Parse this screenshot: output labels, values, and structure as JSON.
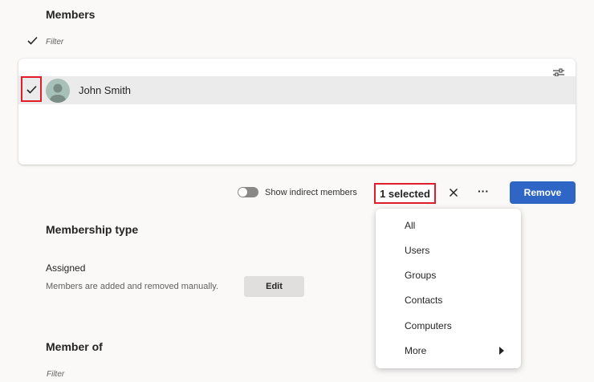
{
  "members": {
    "title": "Members",
    "filter_placeholder": "Filter",
    "rows": [
      {
        "name": "John Smith",
        "selected": true
      }
    ]
  },
  "toolbar": {
    "show_indirect_label": "Show indirect members",
    "selected_count_label": "1 selected",
    "more_label": "···",
    "remove_label": "Remove"
  },
  "membership_type": {
    "title": "Membership type",
    "value": "Assigned",
    "description": "Members are added and removed manually.",
    "edit_label": "Edit"
  },
  "member_of": {
    "title": "Member of",
    "filter_placeholder": "Filter"
  },
  "filter_menu": {
    "items": [
      "All",
      "Users",
      "Groups",
      "Contacts",
      "Computers",
      "More"
    ]
  },
  "colors": {
    "accent": "#2f65c4",
    "highlight": "#e01d2a"
  }
}
